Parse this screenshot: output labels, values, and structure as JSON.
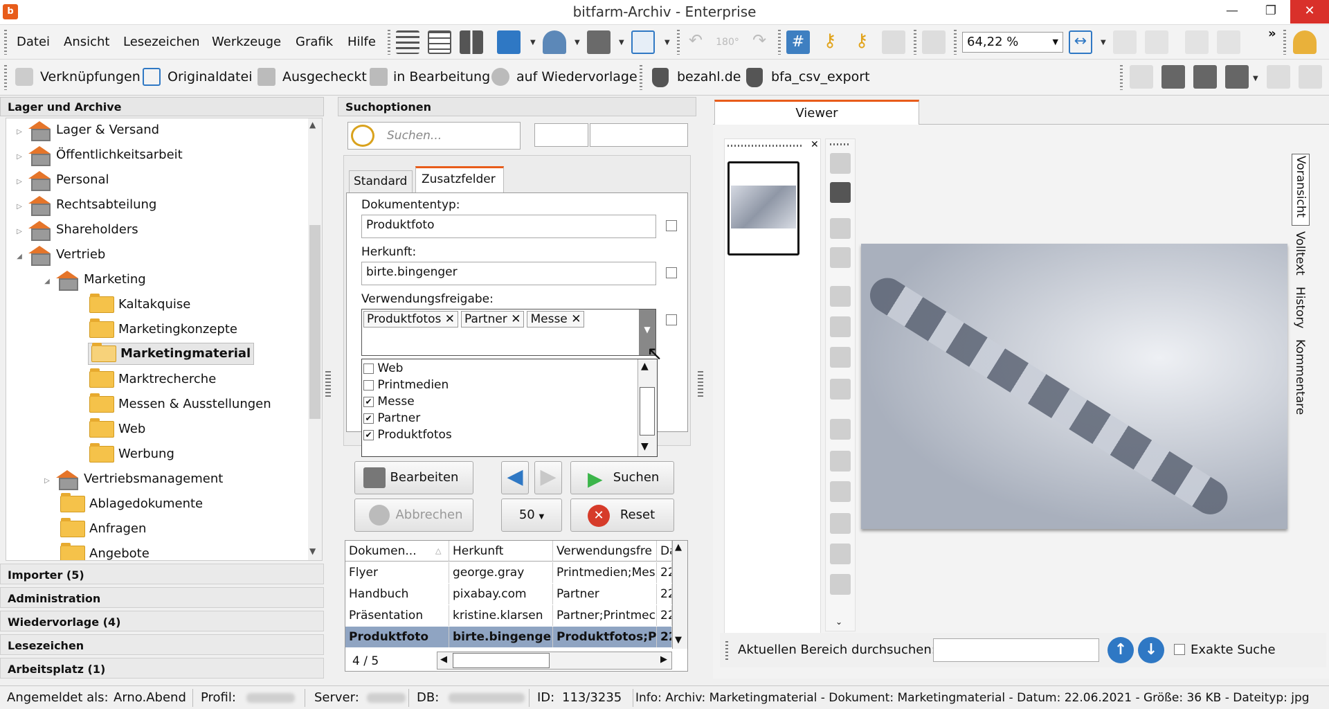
{
  "window": {
    "title": "bitfarm-Archiv - Enterprise",
    "app_icon": "bitfarm-logo-icon"
  },
  "menu": [
    "Datei",
    "Ansicht",
    "Lesezeichen",
    "Werkzeuge",
    "Grafik",
    "Hilfe"
  ],
  "toolbar": {
    "zoom_value": "64,22 %",
    "more_label": "»"
  },
  "toolbar2": {
    "links": "Verknüpfungen",
    "original": "Originaldatei",
    "checked_out": "Ausgecheckt",
    "in_edit": "in Bearbeitung",
    "resubmission": "auf Wiedervorlage",
    "plugin1": "bezahl.de",
    "plugin2": "bfa_csv_export"
  },
  "left_panel": {
    "header": "Lager und Archive",
    "tree": [
      {
        "label": "Lager & Versand"
      },
      {
        "label": "Öffentlichkeitsarbeit"
      },
      {
        "label": "Personal"
      },
      {
        "label": "Rechtsabteilung"
      },
      {
        "label": "Shareholders"
      },
      {
        "label": "Vertrieb"
      },
      {
        "label": "Marketing"
      },
      {
        "label": "Kaltakquise"
      },
      {
        "label": "Marketingkonzepte"
      },
      {
        "label": "Marketingmaterial"
      },
      {
        "label": "Marktrecherche"
      },
      {
        "label": "Messen & Ausstellungen"
      },
      {
        "label": "Web"
      },
      {
        "label": "Werbung"
      },
      {
        "label": "Vertriebsmanagement"
      },
      {
        "label": "Ablagedokumente"
      },
      {
        "label": "Anfragen"
      },
      {
        "label": "Angebote"
      }
    ],
    "sections": [
      "Importer (5)",
      "Administration",
      "Wiedervorlage (4)",
      "Lesezeichen",
      "Arbeitsplatz (1)"
    ]
  },
  "search": {
    "header": "Suchoptionen",
    "placeholder": "Suchen...",
    "tabs": [
      "Standard",
      "Zusatzfelder"
    ],
    "fields": {
      "doctype_label": "Dokumententyp:",
      "doctype_value": "Produktfoto",
      "origin_label": "Herkunft:",
      "origin_value": "birte.bingenger",
      "usage_label": "Verwendungsfreigabe:",
      "usage_tags": [
        "Produktfotos",
        "Partner",
        "Messe"
      ]
    },
    "options": [
      {
        "label": "Web",
        "checked": false
      },
      {
        "label": "Printmedien",
        "checked": false
      },
      {
        "label": "Messe",
        "checked": true
      },
      {
        "label": "Partner",
        "checked": true
      },
      {
        "label": "Produktfotos",
        "checked": true
      }
    ],
    "buttons": {
      "edit": "Bearbeiten",
      "search": "Suchen",
      "cancel": "Abbrechen",
      "reset": "Reset",
      "count": "50"
    }
  },
  "results": {
    "columns": [
      "Dokumen...",
      "Herkunft",
      "Verwendungsfre",
      "Da"
    ],
    "rows": [
      [
        "Flyer",
        "george.gray",
        "Printmedien;Mes",
        "22"
      ],
      [
        "Handbuch",
        "pixabay.com",
        "Partner",
        "22"
      ],
      [
        "Präsentation",
        "kristine.klarsen",
        "Partner;Printmec",
        "22"
      ],
      [
        "Produktfoto",
        "birte.bingenge",
        "Produktfotos;P",
        "22"
      ]
    ],
    "pager": "4 / 5"
  },
  "viewer": {
    "tab": "Viewer",
    "side_tabs": [
      "Voransicht",
      "Volltext",
      "History",
      "Kommentare"
    ],
    "search_label": "Aktuellen Bereich durchsuchen:",
    "exact_label": "Exakte Suche"
  },
  "status": {
    "logged_in_label": "Angemeldet als:",
    "user": "Arno.Abend",
    "profile_label": "Profil:",
    "server_label": "Server:",
    "db_label": "DB:",
    "id_label": "ID:",
    "id_value": "113/3235",
    "info": "Info:  Archiv: Marketingmaterial - Dokument: Marketingmaterial - Datum: 22.06.2021 - Größe: 36 KB - Dateityp: jpg"
  },
  "colors": {
    "accent": "#e85c1a",
    "selection": "#8fa4c2",
    "button_blue": "#2f78c4",
    "reset_red": "#d63b2a",
    "go_green": "#3bb54a"
  }
}
